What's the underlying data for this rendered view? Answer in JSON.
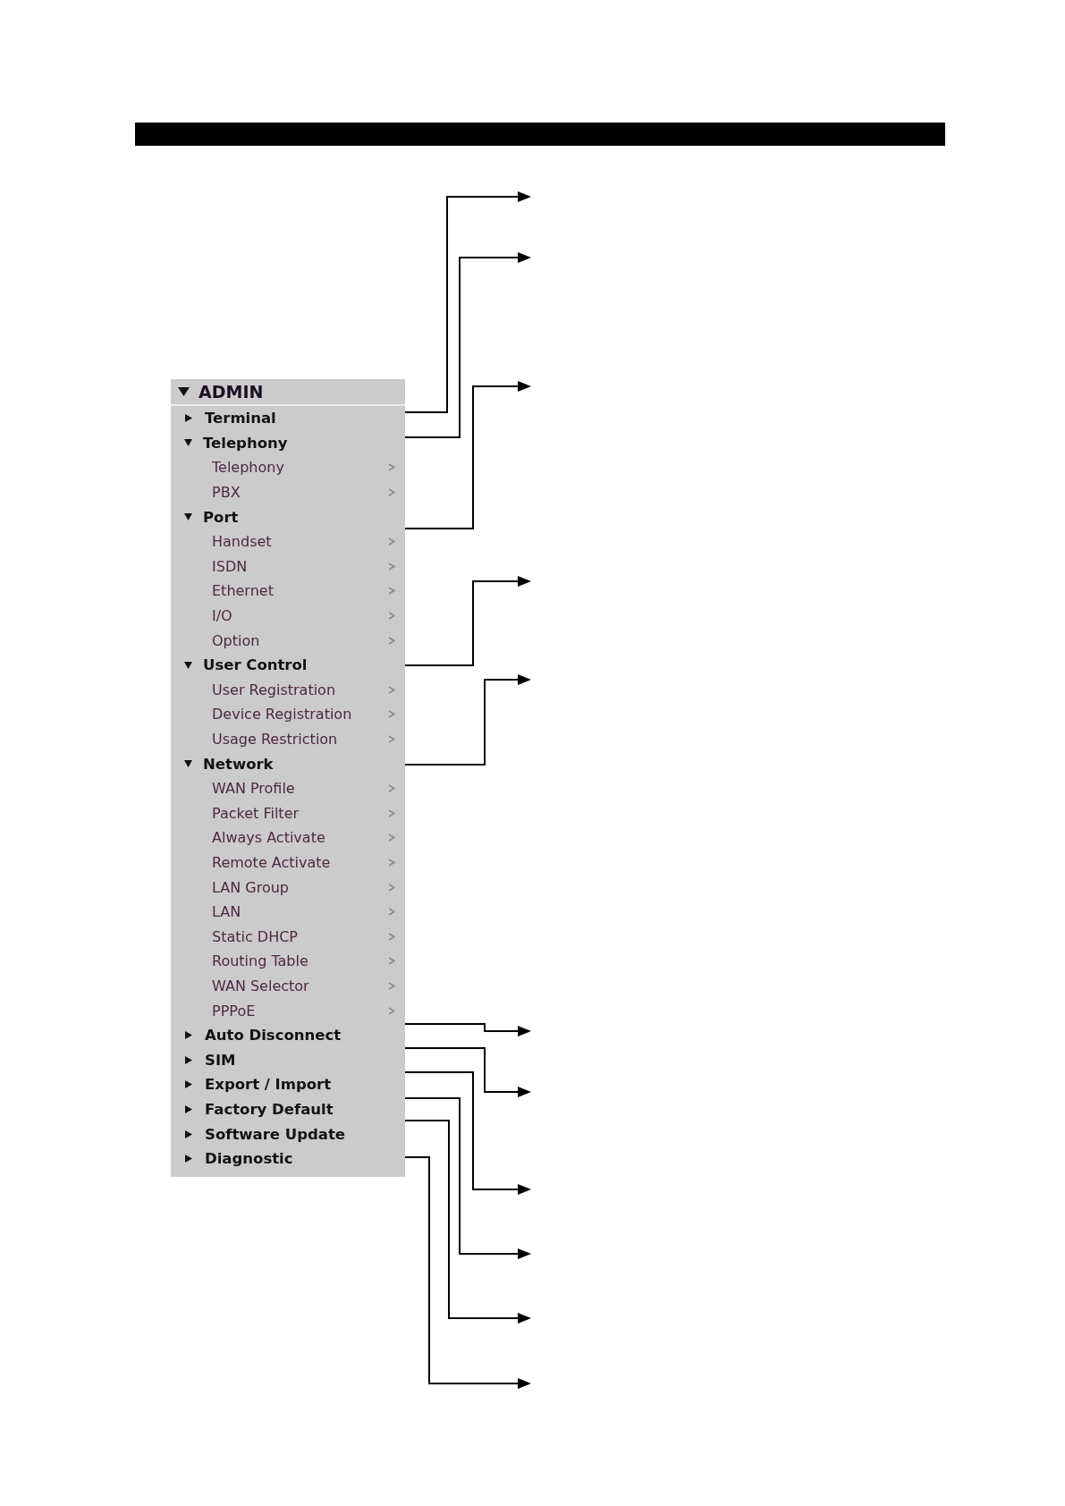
{
  "menu": {
    "label": "ADMIN",
    "expanded": true,
    "children": [
      {
        "kind": "section",
        "label": "Terminal",
        "expanded": false
      },
      {
        "kind": "section",
        "label": "Telephony",
        "expanded": true,
        "children": [
          {
            "kind": "page",
            "label": "Telephony"
          },
          {
            "kind": "page",
            "label": "PBX"
          }
        ]
      },
      {
        "kind": "section",
        "label": "Port",
        "expanded": true,
        "children": [
          {
            "kind": "page",
            "label": "Handset"
          },
          {
            "kind": "page",
            "label": "ISDN"
          },
          {
            "kind": "page",
            "label": "Ethernet"
          },
          {
            "kind": "page",
            "label": "I/O"
          },
          {
            "kind": "page",
            "label": "Option"
          }
        ]
      },
      {
        "kind": "section",
        "label": "User Control",
        "expanded": true,
        "children": [
          {
            "kind": "page",
            "label": "User Registration"
          },
          {
            "kind": "page",
            "label": "Device Registration"
          },
          {
            "kind": "page",
            "label": "Usage Restriction"
          }
        ]
      },
      {
        "kind": "section",
        "label": "Network",
        "expanded": true,
        "children": [
          {
            "kind": "page",
            "label": "WAN Profile"
          },
          {
            "kind": "page",
            "label": "Packet Filter"
          },
          {
            "kind": "page",
            "label": "Always Activate"
          },
          {
            "kind": "page",
            "label": "Remote Activate"
          },
          {
            "kind": "page",
            "label": "LAN Group"
          },
          {
            "kind": "page",
            "label": "LAN"
          },
          {
            "kind": "page",
            "label": "Static DHCP"
          },
          {
            "kind": "page",
            "label": "Routing Table"
          },
          {
            "kind": "page",
            "label": "WAN Selector"
          },
          {
            "kind": "page",
            "label": "PPPoE"
          }
        ]
      },
      {
        "kind": "section",
        "label": "Auto Disconnect",
        "expanded": false
      },
      {
        "kind": "section",
        "label": "SIM",
        "expanded": false
      },
      {
        "kind": "section",
        "label": "Export / Import",
        "expanded": false
      },
      {
        "kind": "section",
        "label": "Factory Default",
        "expanded": false
      },
      {
        "kind": "section",
        "label": "Software Update",
        "expanded": false
      },
      {
        "kind": "section",
        "label": "Diagnostic",
        "expanded": false
      }
    ]
  }
}
